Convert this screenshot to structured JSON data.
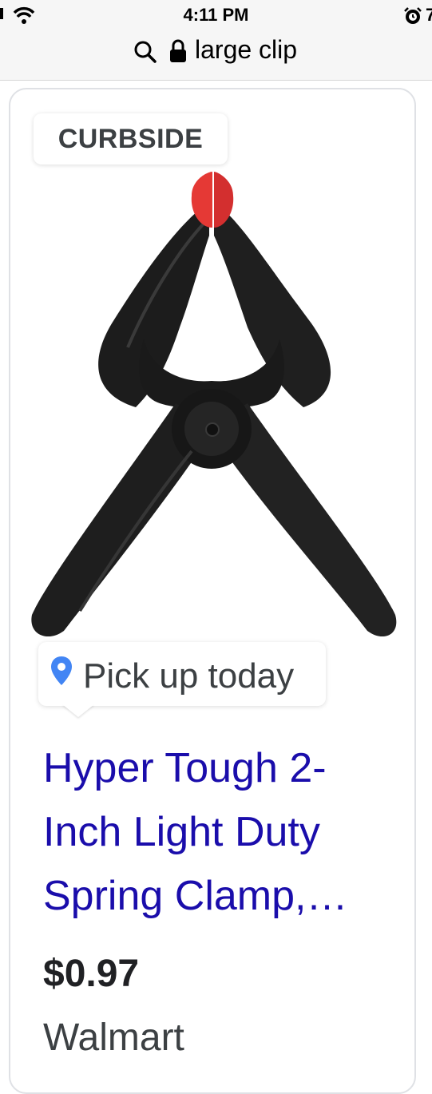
{
  "status_bar": {
    "time": "4:11 PM",
    "battery": "7",
    "icons": [
      "wifi-icon",
      "alarm-icon"
    ]
  },
  "url_bar": {
    "query": "large clip",
    "icons": [
      "search-icon",
      "lock-icon"
    ]
  },
  "result": {
    "badge": "CURBSIDE",
    "pickup_label": "Pick up today",
    "title_lines": [
      "Hyper Tough 2-",
      "Inch Light Duty",
      "Spring Clamp,…"
    ],
    "price": "$0.97",
    "store": "Walmart",
    "image_icon": "spring-clamp-image"
  },
  "colors": {
    "link": "#1a0dab",
    "pin": "#4285f4",
    "clamp_body": "#1f1f1f",
    "clamp_tip": "#e53935"
  }
}
